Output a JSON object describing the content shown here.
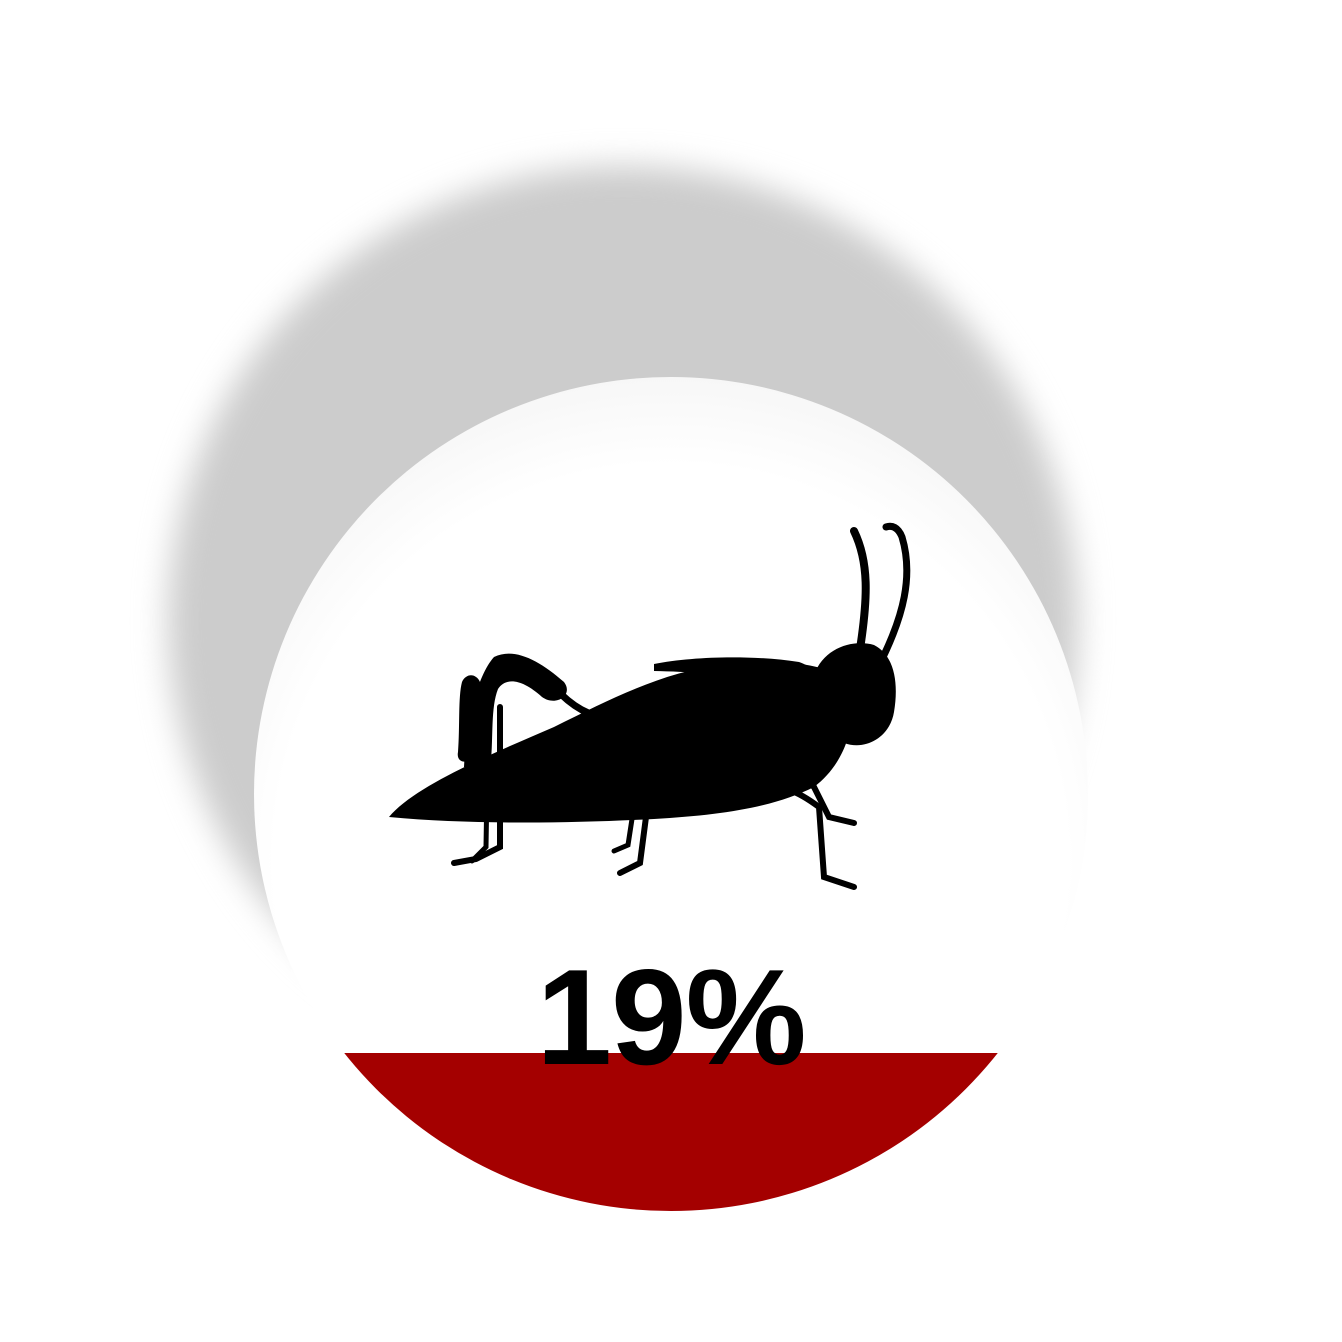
{
  "badge": {
    "percent_label": "19%",
    "fill_level": 0.19,
    "icon": "grasshopper-icon"
  },
  "colors": {
    "fill": "#a40000",
    "shadow": "#cccccc",
    "text": "#000000",
    "badge": "#ffffff"
  }
}
